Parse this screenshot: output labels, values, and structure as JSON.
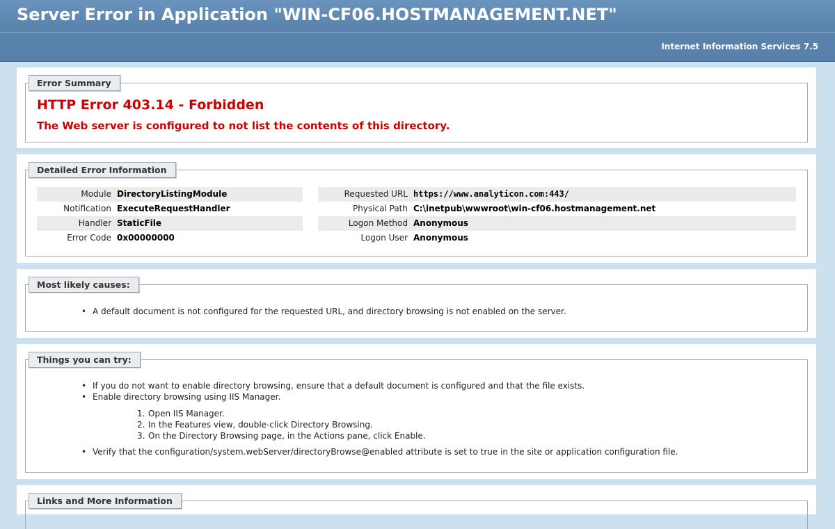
{
  "header": {
    "title": "Server Error in Application \"WIN-CF06.HOSTMANAGEMENT.NET\"",
    "subtitle": "Internet Information Services 7.5"
  },
  "summary": {
    "legend": "Error Summary",
    "title": "HTTP Error 403.14 - Forbidden",
    "message": "The Web server is configured to not list the contents of this directory."
  },
  "details": {
    "legend": "Detailed Error Information",
    "left": [
      {
        "label": "Module",
        "value": "DirectoryListingModule"
      },
      {
        "label": "Notification",
        "value": "ExecuteRequestHandler"
      },
      {
        "label": "Handler",
        "value": "StaticFile"
      },
      {
        "label": "Error Code",
        "value": "0x00000000"
      }
    ],
    "right": [
      {
        "label": "Requested URL",
        "value": "https://www.analyticon.com:443/"
      },
      {
        "label": "Physical Path",
        "value": "C:\\inetpub\\wwwroot\\win-cf06.hostmanagement.net"
      },
      {
        "label": "Logon Method",
        "value": "Anonymous"
      },
      {
        "label": "Logon User",
        "value": "Anonymous"
      }
    ]
  },
  "causes": {
    "legend": "Most likely causes:",
    "items": [
      "A default document is not configured for the requested URL, and directory browsing is not enabled on the server."
    ]
  },
  "tries": {
    "legend": "Things you can try:",
    "items": [
      "If you do not want to enable directory browsing, ensure that a default document is configured and that the file exists.",
      "Enable directory browsing using IIS Manager."
    ],
    "steps": [
      "Open IIS Manager.",
      "In the Features view, double-click Directory Browsing.",
      "On the Directory Browsing page, in the Actions pane, click Enable."
    ],
    "last_item": "Verify that the configuration/system.webServer/directoryBrowse@enabled attribute is set to true in the site or application configuration file."
  },
  "links": {
    "legend": "Links and More Information"
  }
}
